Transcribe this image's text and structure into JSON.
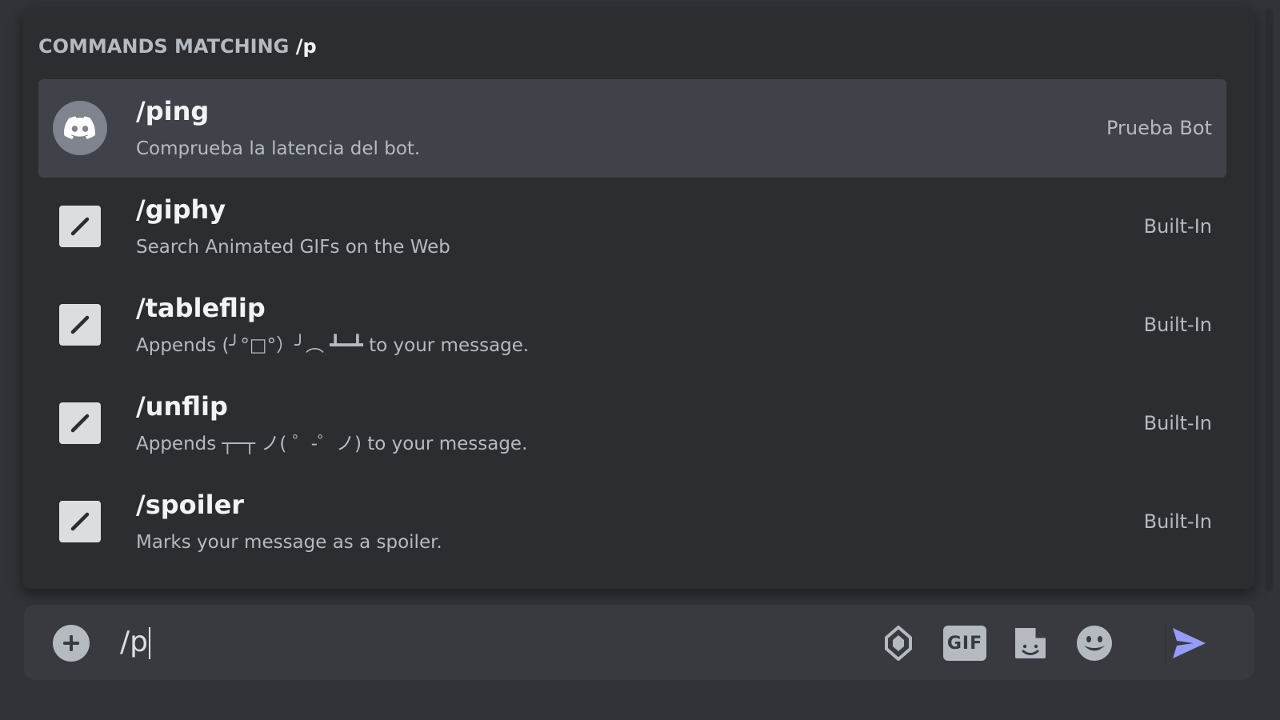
{
  "autocomplete": {
    "header_prefix": "COMMANDS MATCHING",
    "header_query": "/p",
    "commands": [
      {
        "name": "/ping",
        "description": "Comprueba la latencia del bot.",
        "source": "Prueba Bot",
        "icon": "discord-bot-avatar-icon",
        "selected": true
      },
      {
        "name": "/giphy",
        "description": "Search Animated GIFs on the Web",
        "source": "Built-In",
        "icon": "slash-command-icon",
        "selected": false
      },
      {
        "name": "/tableflip",
        "description": "Appends (╯°□°）╯︵ ┻━┻ to your message.",
        "source": "Built-In",
        "icon": "slash-command-icon",
        "selected": false
      },
      {
        "name": "/unflip",
        "description": "Appends ┬─┬ ノ( ゜-゜ノ) to your message.",
        "source": "Built-In",
        "icon": "slash-command-icon",
        "selected": false
      },
      {
        "name": "/spoiler",
        "description": "Marks your message as a spoiler.",
        "source": "Built-In",
        "icon": "slash-command-icon",
        "selected": false
      }
    ]
  },
  "chatbar": {
    "input_value": "/p",
    "add_icon": "plus-circle-icon",
    "gift_icon": "nitro-gem-icon",
    "gif_label": "GIF",
    "sticker_icon": "sticker-icon",
    "emoji_icon": "emoji-smile-icon",
    "send_icon": "send-arrow-icon"
  },
  "colors": {
    "background": "#313338",
    "popup": "#2b2d31",
    "selected_row": "#3f4248",
    "chatbar": "#383a40",
    "send_accent": "#949cf7"
  }
}
